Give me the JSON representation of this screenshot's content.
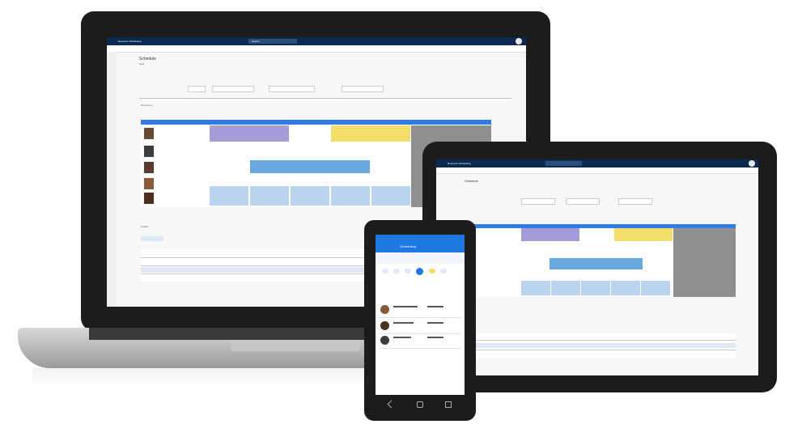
{
  "laptop": {
    "app_title": "Resource Scheduling",
    "search_placeholder": "Search",
    "page_title": "Schedule",
    "status_title": "New",
    "section_resources": "Resources",
    "section_details": "Details",
    "colors": {
      "header_bar": "#0b2a52",
      "grid_header": "#2f7de1",
      "booking_purple": "#a79ad8",
      "booking_yellow": "#f4dd6a",
      "booking_blue": "#6aa6df",
      "unavailable_grey": "#8f8f8f"
    }
  },
  "tablet": {
    "app_title": "Resource Scheduling",
    "page_title": "Schedule"
  },
  "phone": {
    "header_title": "Scheduling",
    "list": [
      {
        "name": "",
        "time": ""
      },
      {
        "name": "",
        "time": ""
      },
      {
        "name": "",
        "time": ""
      }
    ]
  }
}
